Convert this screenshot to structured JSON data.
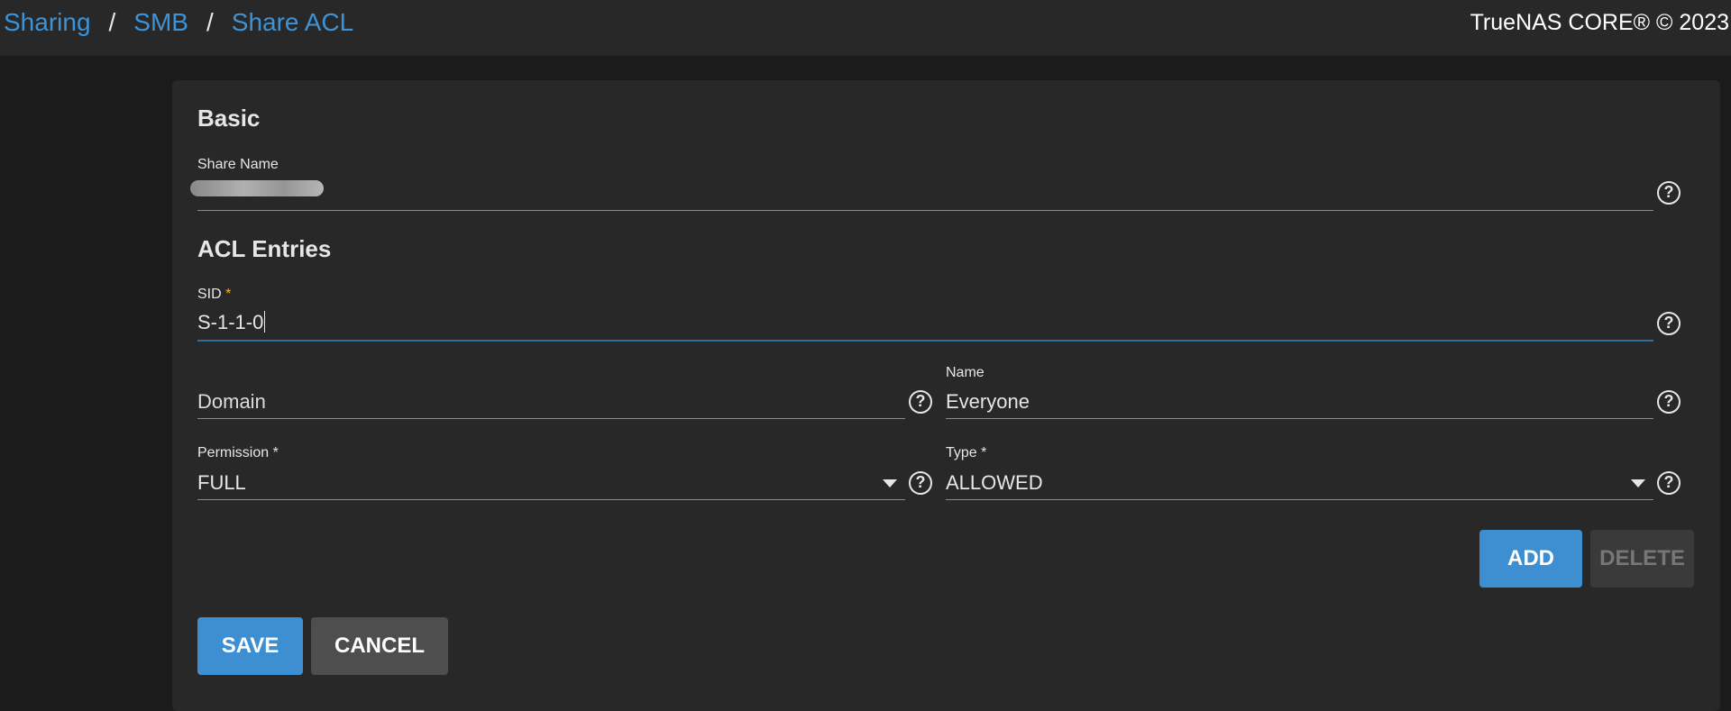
{
  "breadcrumb": {
    "items": [
      "Sharing",
      "SMB",
      "Share ACL"
    ],
    "separator": "/"
  },
  "header": {
    "copyright": "TrueNAS CORE® © 2023"
  },
  "form": {
    "basic": {
      "title": "Basic",
      "share_name": {
        "label": "Share Name",
        "value": ""
      }
    },
    "acl": {
      "title": "ACL Entries",
      "sid": {
        "label": "SID",
        "required_mark": "*",
        "value": "S-1-1-0"
      },
      "domain": {
        "placeholder": "Domain",
        "value": ""
      },
      "name": {
        "label": "Name",
        "value": "Everyone"
      },
      "permission": {
        "label": "Permission *",
        "value": "FULL"
      },
      "type": {
        "label": "Type *",
        "value": "ALLOWED"
      },
      "add_label": "ADD",
      "delete_label": "DELETE"
    },
    "save_label": "SAVE",
    "cancel_label": "CANCEL"
  },
  "icons": {
    "help": "help-circle-icon",
    "dropdown": "caret-down-icon"
  },
  "colors": {
    "accent": "#3d8fd1",
    "link": "#3d93d6",
    "required": "#f0b429",
    "focus_underline": "#2f6f9f"
  }
}
